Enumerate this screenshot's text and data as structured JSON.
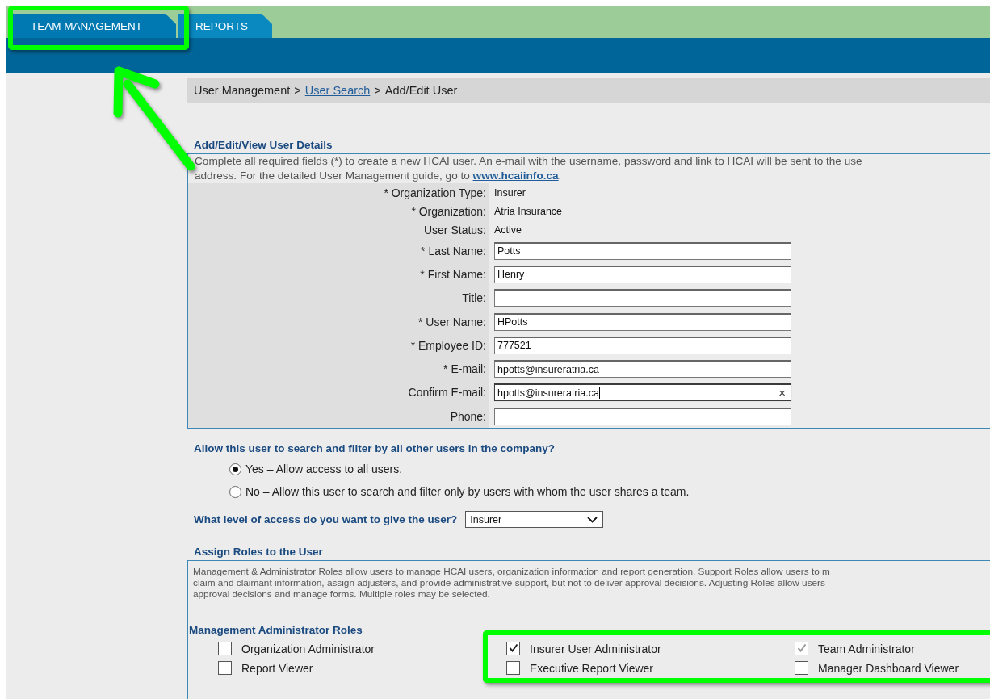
{
  "tabs": [
    {
      "label": "TEAM MANAGEMENT",
      "selected": true
    },
    {
      "label": "REPORTS",
      "selected": false
    }
  ],
  "breadcrumb": {
    "separator": ">",
    "items": [
      {
        "text": "User Management",
        "link": false
      },
      {
        "text": "User Search",
        "link": true
      },
      {
        "text": "Add/Edit User",
        "link": false
      }
    ]
  },
  "details": {
    "title": "Add/Edit/View User Details",
    "intro": {
      "line_1": "Complete all required fields (*) to create a new HCAI user. An e-mail with the username, password and link to HCAI will be sent to the use",
      "line_2": "address. For the detailed User Management guide, go to",
      "link": "www.hcaiinfo.ca",
      "end": "."
    },
    "fields": [
      {
        "label": "* Organization Type:",
        "kind": "static",
        "value": "Insurer"
      },
      {
        "label": "* Organization:",
        "kind": "static",
        "value": "Atria Insurance"
      },
      {
        "label": "User Status:",
        "kind": "static",
        "value": "Active"
      },
      {
        "label": "* Last Name:",
        "kind": "input",
        "value": "Potts",
        "focused": false
      },
      {
        "label": "* First Name:",
        "kind": "input",
        "value": "Henry",
        "focused": false
      },
      {
        "label": "Title:",
        "kind": "input",
        "focused": false
      },
      {
        "label": "* User Name:",
        "kind": "input",
        "value": "HPotts",
        "focused": false
      },
      {
        "label": "* Employee ID:",
        "kind": "input",
        "value": "777521",
        "focused": false
      },
      {
        "label": "* E-mail:",
        "kind": "input",
        "value": "hpotts@insureratria.ca",
        "focused": false
      },
      {
        "label": "Confirm E-mail:",
        "kind": "input",
        "value": "hpotts@insureratria.ca",
        "focused": true,
        "clear_icon": "×"
      },
      {
        "label": "Phone:",
        "kind": "input",
        "focused": false
      }
    ]
  },
  "search_scope": {
    "question": "Allow this user to search and filter by all other users in the company?",
    "options": [
      {
        "label": "Yes – Allow access to all users.",
        "selected": true
      },
      {
        "label": "No – Allow this user to search and filter only by users with whom the user shares a team.",
        "selected": false
      }
    ]
  },
  "access_level": {
    "question": "What level of access do you want to give the user?",
    "value": "Insurer"
  },
  "roles": {
    "title": "Assign Roles to the User",
    "description_lines": [
      "Management & Administrator Roles allow users to manage HCAI users, organization information and report generation. Support Roles allow users to m",
      "claim and claimant information, assign adjusters, and provide administrative support, but not to deliver approval decisions. Adjusting Roles allow users",
      "approval decisions and manage forms. Multiple roles may be selected."
    ],
    "groups": [
      {
        "title": "Management Administrator Roles",
        "roles": [
          {
            "label": "Organization Administrator",
            "checked": false,
            "disabled": false
          },
          {
            "label": "Insurer User Administrator",
            "checked": true,
            "disabled": false
          },
          {
            "label": "Team Administrator",
            "checked": true,
            "disabled": true
          },
          {
            "label": "Report Viewer",
            "checked": false,
            "disabled": false
          },
          {
            "label": "Executive Report Viewer",
            "checked": false,
            "disabled": false
          },
          {
            "label": "Manager Dashboard Viewer",
            "checked": false,
            "disabled": false
          }
        ]
      }
    ]
  }
}
